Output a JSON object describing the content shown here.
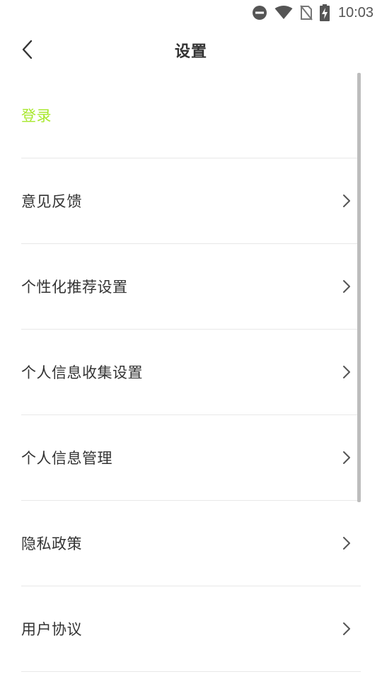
{
  "status_bar": {
    "time": "10:03",
    "icons": [
      "do-not-disturb-icon",
      "wifi-icon",
      "no-sim-icon",
      "battery-charging-icon"
    ]
  },
  "header": {
    "title": "设置",
    "back_icon": "chevron-left-icon"
  },
  "colors": {
    "login_accent": "#a8e82e",
    "text": "#333333",
    "divider": "#e8e8e8"
  },
  "settings": {
    "items": [
      {
        "label": "登录",
        "has_chevron": false
      },
      {
        "label": "意见反馈",
        "has_chevron": true
      },
      {
        "label": "个性化推荐设置",
        "has_chevron": true
      },
      {
        "label": "个人信息收集设置",
        "has_chevron": true
      },
      {
        "label": "个人信息管理",
        "has_chevron": true
      },
      {
        "label": "隐私政策",
        "has_chevron": true
      },
      {
        "label": "用户协议",
        "has_chevron": true
      }
    ]
  }
}
